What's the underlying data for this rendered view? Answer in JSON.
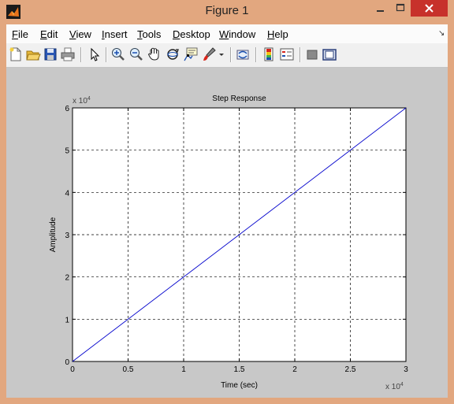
{
  "window": {
    "title": "Figure 1"
  },
  "menu": [
    {
      "pre": "",
      "u": "F",
      "post": "ile"
    },
    {
      "pre": "",
      "u": "E",
      "post": "dit"
    },
    {
      "pre": "",
      "u": "V",
      "post": "iew"
    },
    {
      "pre": "",
      "u": "I",
      "post": "nsert"
    },
    {
      "pre": "",
      "u": "T",
      "post": "ools"
    },
    {
      "pre": "",
      "u": "D",
      "post": "esktop"
    },
    {
      "pre": "",
      "u": "W",
      "post": "indow"
    },
    {
      "pre": "",
      "u": "H",
      "post": "elp"
    }
  ],
  "toolbar": [
    "new-figure-icon",
    "open-file-icon",
    "save-icon",
    "print-icon",
    "edit-plot-arrow-icon",
    "zoom-in-icon",
    "zoom-out-icon",
    "pan-hand-icon",
    "rotate-3d-icon",
    "data-cursor-icon",
    "brush-icon",
    "link-plot-icon",
    "insert-colorbar-icon",
    "insert-legend-icon",
    "hide-plot-tools-icon",
    "show-plot-tools-icon"
  ],
  "colors": {
    "accent": "#0000cc",
    "close": "#c7312b"
  },
  "chart_data": {
    "type": "line",
    "title": "Step Response",
    "xlabel": "Time (sec)",
    "ylabel": "Amplitude",
    "x_exponent_label": "x 10",
    "x_exponent": "4",
    "y_exponent_label": "x 10",
    "y_exponent": "4",
    "xlim": [
      0,
      3
    ],
    "ylim": [
      0,
      6
    ],
    "x_ticks": [
      0,
      0.5,
      1,
      1.5,
      2,
      2.5,
      3
    ],
    "x_tick_labels": [
      "0",
      "0.5",
      "1",
      "1.5",
      "2",
      "2.5",
      "3"
    ],
    "y_ticks": [
      0,
      1,
      2,
      3,
      4,
      5,
      6
    ],
    "y_tick_labels": [
      "0",
      "1",
      "2",
      "3",
      "4",
      "5",
      "6"
    ],
    "grid": true,
    "series": [
      {
        "x": [
          0,
          3
        ],
        "y": [
          0,
          6
        ],
        "color": "#0000cc"
      }
    ]
  }
}
